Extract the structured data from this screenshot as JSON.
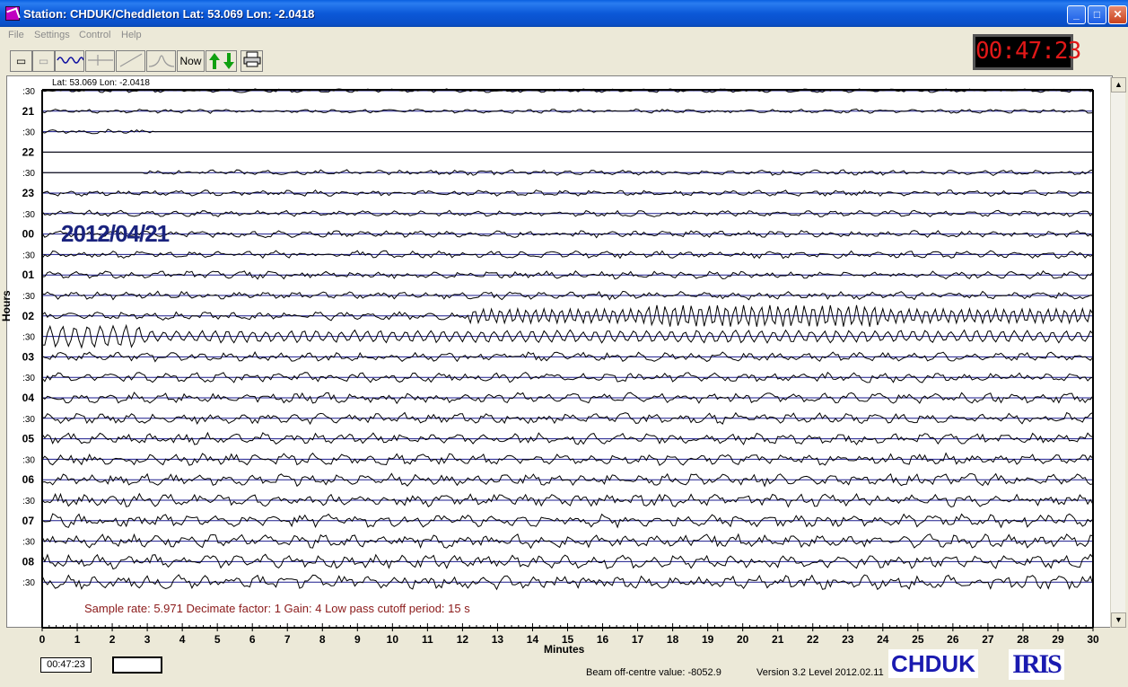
{
  "window": {
    "title": "Station: CHDUK/Cheddleton Lat: 53.069 Lon: -2.0418"
  },
  "menu": {
    "items": [
      "File",
      "Settings",
      "Control",
      "Help"
    ]
  },
  "toolbar": {
    "now_label": "Now"
  },
  "clock": {
    "value": "00:47:23"
  },
  "plot": {
    "latlon": "Lat: 53.069 Lon: -2.0418",
    "date": "2012/04/21",
    "hour_labels": [
      ":30",
      "21",
      ":30",
      "22",
      ":30",
      "23",
      ":30",
      "00",
      ":30",
      "01",
      ":30",
      "02",
      ":30",
      "03",
      ":30",
      "04",
      ":30",
      "05",
      ":30",
      "06",
      ":30",
      "07",
      ":30",
      "08",
      ":30"
    ],
    "minute_ticks": [
      "0",
      "1",
      "2",
      "3",
      "4",
      "5",
      "6",
      "7",
      "8",
      "9",
      "10",
      "11",
      "12",
      "13",
      "14",
      "15",
      "16",
      "17",
      "18",
      "19",
      "20",
      "21",
      "22",
      "23",
      "24",
      "25",
      "26",
      "27",
      "28",
      "29",
      "30"
    ],
    "x_axis_label": "Minutes",
    "y_axis_label": "Hours",
    "info": "Sample rate: 5.971  Decimate factor: 1  Gain: 4  Low pass cutoff period: 15 s"
  },
  "status": {
    "time": "00:47:23",
    "beam": "Beam off-centre value: -8052.9",
    "version": "Version 3.2 Level 2012.02.11",
    "logo_chduk": "CHDUK",
    "logo_iris": "IRIS"
  },
  "colors": {
    "trace": "#000000",
    "baseline": "#1a1a8c",
    "info": "#8b1a1a",
    "date": "#1a237e",
    "clock": "#e01818"
  }
}
